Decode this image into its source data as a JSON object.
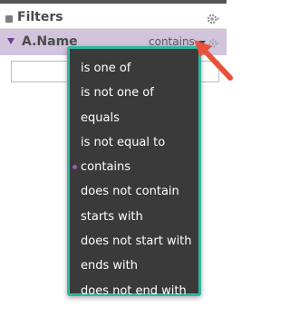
{
  "panel": {
    "title": "Filters"
  },
  "filter": {
    "field_name": "A.Name",
    "operator": "contains",
    "value": ""
  },
  "menu": {
    "items": [
      {
        "label": "is one of",
        "selected": false
      },
      {
        "label": "is not one of",
        "selected": false
      },
      {
        "label": "equals",
        "selected": false
      },
      {
        "label": "is not equal to",
        "selected": false
      },
      {
        "label": "contains",
        "selected": true
      },
      {
        "label": "does not contain",
        "selected": false
      },
      {
        "label": "starts with",
        "selected": false
      },
      {
        "label": "does not start with",
        "selected": false
      },
      {
        "label": "ends with",
        "selected": false
      },
      {
        "label": "does not end with",
        "selected": false
      }
    ]
  },
  "colors": {
    "menu_border": "#2db7a3",
    "menu_bg": "#3a3a3a",
    "row_bg": "#d2c4dd",
    "accent": "#6c3c8f",
    "annotation_arrow": "#e8513a"
  }
}
